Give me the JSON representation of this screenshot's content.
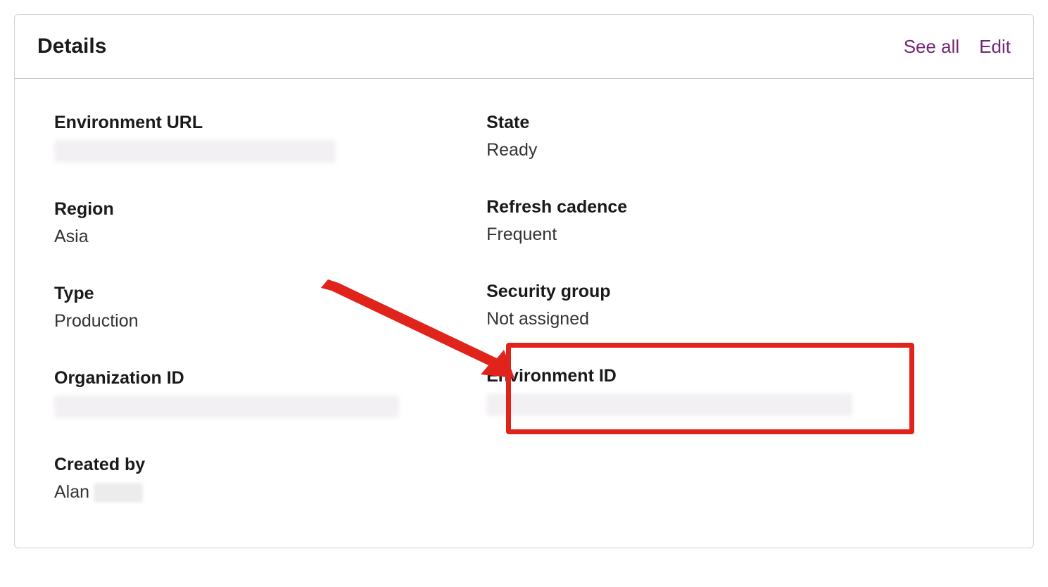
{
  "header": {
    "title": "Details",
    "see_all_label": "See all",
    "edit_label": "Edit"
  },
  "fields": {
    "environment_url": {
      "label": "Environment URL"
    },
    "region": {
      "label": "Region",
      "value": "Asia"
    },
    "type": {
      "label": "Type",
      "value": "Production"
    },
    "organization_id": {
      "label": "Organization ID"
    },
    "created_by": {
      "label": "Created by",
      "value": "Alan"
    },
    "state": {
      "label": "State",
      "value": "Ready"
    },
    "refresh_cadence": {
      "label": "Refresh cadence",
      "value": "Frequent"
    },
    "security_group": {
      "label": "Security group",
      "value": "Not assigned"
    },
    "environment_id": {
      "label": "Environment ID"
    }
  },
  "annotation": {
    "highlight_color": "#e0241b"
  }
}
